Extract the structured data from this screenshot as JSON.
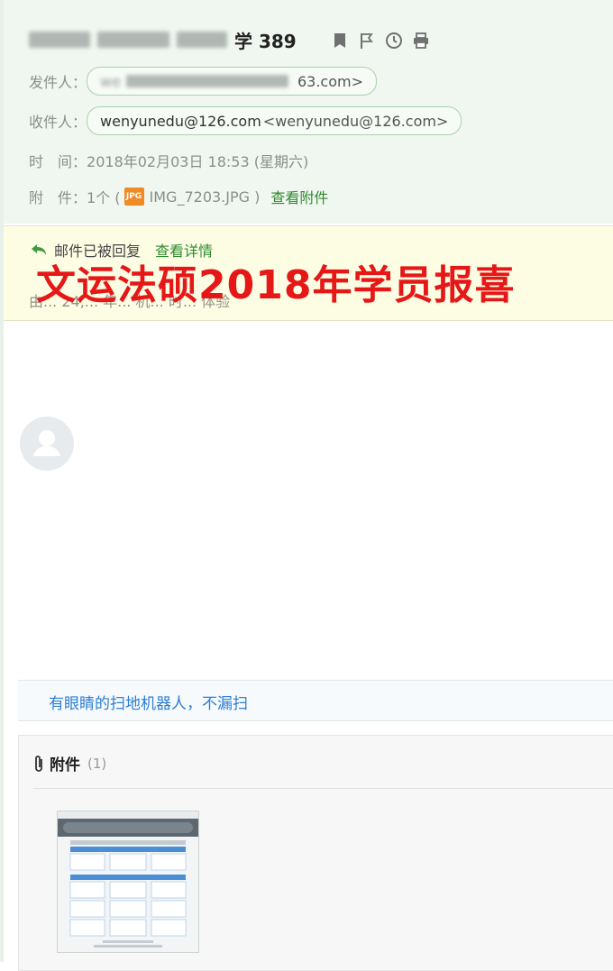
{
  "header": {
    "subject_suffix": "学 389",
    "sender_label": "发件人：",
    "sender_addr_visible": "63.com>",
    "sender_blurred": "we",
    "recipient_label": "收件人：",
    "recipient_name": "wenyunedu@126.com",
    "recipient_addr": "<wenyunedu@126.com>",
    "time_label": "时　间：",
    "time_value": "2018年02月03日 18:53 (星期六)",
    "attach_label": "附　件：",
    "attach_count": "1个 (",
    "attach_badge": "JPG",
    "attach_file": "IMG_7203.JPG )",
    "attach_view": "查看附件"
  },
  "reply_bar": {
    "status": "邮件已被回复",
    "detail_link": "查看详情",
    "ad_text": "由... 24,... 年... 机... 时... 体验"
  },
  "overlay_title": "文运法硕2018年学员报喜",
  "promo": {
    "text": "有眼睛的扫地机器人，不漏扫"
  },
  "attachments": {
    "label": "附件",
    "count": "(1)"
  },
  "colors": {
    "header_bg": "#f0f6f0",
    "accent_green": "#2f8a2f",
    "overlay_red": "#e61717",
    "link_blue": "#2b7ed6",
    "reply_bg": "#fdfde4"
  },
  "icons": [
    "bookmark-icon",
    "flag-icon",
    "clock-icon",
    "print-icon",
    "reply-arrow-icon",
    "paperclip-icon",
    "avatar-icon"
  ]
}
